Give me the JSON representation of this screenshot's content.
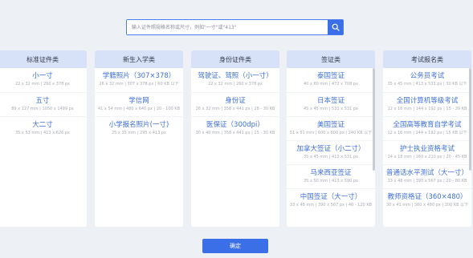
{
  "search": {
    "placeholder": "输入证件照规格名称或尺寸，例如\"一寸\"或\"413\""
  },
  "confirm_label": "确定",
  "columns": [
    {
      "title": "标准证件类",
      "items": [
        {
          "name": "小一寸",
          "spec": "22 x 32 mm | 260 x 378 px"
        },
        {
          "name": "五寸",
          "spec": "89 x 127 mm | 1050 x 1499 px"
        },
        {
          "name": "大二寸",
          "spec": "35 x 53 mm | 413 x 626 px"
        }
      ]
    },
    {
      "title": "新生入学类",
      "items": [
        {
          "name": "学籍照片（307×378）",
          "spec": "26 x 32 mm | 307 x 378 px | 60 KB 以下"
        },
        {
          "name": "学信网",
          "spec": "41 x 54 mm | 480 x 640 px | 20 - 100 KB"
        },
        {
          "name": "小学报名照片(一寸)",
          "spec": "25 x 35 mm | 295 x 413 px"
        }
      ]
    },
    {
      "title": "身份证件类",
      "items": [
        {
          "name": "驾驶证、驾照（小一寸）",
          "spec": "22 x 32 mm | 260 x 378 px"
        },
        {
          "name": "身份证",
          "spec": "26 x 32 mm | 358 x 441 px | 28 - 30 KB"
        },
        {
          "name": "医保证（300dpi）",
          "spec": "30 x 40 mm | 358 x 441 px | 15 - 30 KB"
        }
      ]
    },
    {
      "title": "签证类",
      "items": [
        {
          "name": "泰国签证",
          "spec": "40 x 60 mm | 472 x 708 px"
        },
        {
          "name": "日本签证",
          "spec": "45 x 45 mm | 531 x 531 px"
        },
        {
          "name": "美国签证",
          "spec": "51 x 51 mm | 600 x 600 px | 240 KB 以下"
        },
        {
          "name": "加拿大签证（小二寸）",
          "spec": "35 x 45 mm | 413 x 531 px"
        },
        {
          "name": "马来西亚签证",
          "spec": "35 x 50 mm | 413 x 590 px"
        },
        {
          "name": "中国签证（大一寸）",
          "spec": "33 x 48 mm | 390 x 567 px | 40 - 120 KB"
        }
      ]
    },
    {
      "title": "考试报名类",
      "items": [
        {
          "name": "公务员考试",
          "spec": "35 x 45 mm | 413 x 531 px | 30 KB 以下"
        },
        {
          "name": "全国计算机等级考试",
          "spec": "12 x 16 mm | 144 x 192 px | 15 - 20 KB"
        },
        {
          "name": "全国高等教育自学考试",
          "spec": "12 x 16 mm | 144 x 192 px | 15 KB 以下"
        },
        {
          "name": "护士执业资格考试",
          "spec": "14 x 18 mm | 160 x 210 px | 20 - 45 KB"
        },
        {
          "name": "普通话水平测试（大一寸）",
          "spec": "33 x 48 mm | 390 x 567 px | 20 - 80 KB"
        },
        {
          "name": "教师资格证（360×480）",
          "spec": "30 x 41 mm | 360 x 480 px | 200 KB 以下"
        }
      ]
    }
  ]
}
